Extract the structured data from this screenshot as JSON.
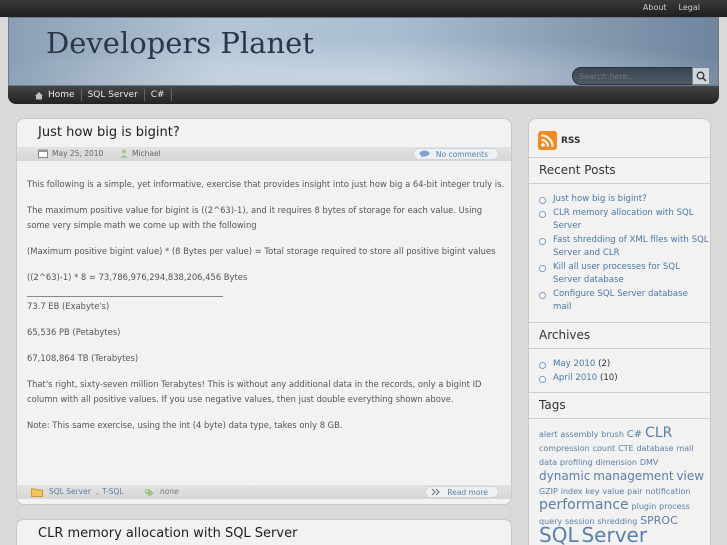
{
  "topbar": {
    "about": "About",
    "legal": "Legal"
  },
  "header": {
    "title": "Developers Planet",
    "search_placeholder": "Search here..."
  },
  "nav": {
    "items": [
      "Home",
      "SQL Server",
      "C#"
    ]
  },
  "post1": {
    "title": "Just how big is bigint?",
    "date": "May 25, 2010",
    "author": "Michael",
    "comments": "No comments",
    "paragraphs": [
      "This following is a simple, yet informative, exercise that provides insight into just how big a 64-bit integer truly is.",
      "The maximum positive value for bigint is ((2^63)-1), and it requires 8 bytes of storage for each value. Using some very simple math we come up with the following",
      "(Maximum positive bigint value) * (8 Bytes per value) = Total storage required to store all positive bigint values",
      "((2^63)-1) * 8 = 73,786,976,294,838,206,456 Bytes"
    ],
    "sizes": [
      "73.7 EB (Exabyte's)",
      "65,536 PB (Petabytes)",
      "67,108,864 TB (Terabytes)"
    ],
    "paragraphs2": [
      "That's right, sixty-seven million Terabytes! This is without any additional data in the records, only a bigint ID column with all positive values. If you use negative values, then just double everything shown above.",
      "Note: This same exercise, using the int (4 byte) data type, takes only 8 GB."
    ],
    "categories": [
      "SQL Server",
      "T-SQL"
    ],
    "category_sep": ",",
    "tags": "none",
    "read_more": "Read more"
  },
  "post2": {
    "title": "CLR memory allocation with SQL Server"
  },
  "sidebar": {
    "rss": "RSS",
    "recent_heading": "Recent Posts",
    "recent": [
      "Just how big is bigint?",
      "CLR memory allocation with SQL Server",
      "Fast shredding of XML files with SQL Server and CLR",
      "Kill all user processes for SQL Server database",
      "Configure SQL Server database mail"
    ],
    "archives_heading": "Archives",
    "archives": [
      {
        "label": "May 2010",
        "count": "(2)"
      },
      {
        "label": "April 2010",
        "count": "(10)"
      }
    ],
    "tags_heading": "Tags",
    "tags": [
      {
        "text": "alert",
        "size": 8
      },
      {
        "text": "assembly",
        "size": 8
      },
      {
        "text": "brush",
        "size": 8
      },
      {
        "text": "C#",
        "size": 10
      },
      {
        "text": "CLR",
        "size": 14
      },
      {
        "text": "compression",
        "size": 8
      },
      {
        "text": "count",
        "size": 8
      },
      {
        "text": "CTE",
        "size": 8
      },
      {
        "text": "database",
        "size": 8
      },
      {
        "text": "mail",
        "size": 8
      },
      {
        "text": "data",
        "size": 8
      },
      {
        "text": "profiling",
        "size": 8
      },
      {
        "text": "dimension",
        "size": 8
      },
      {
        "text": "DMV",
        "size": 8
      },
      {
        "text": "dynamic",
        "size": 12
      },
      {
        "text": "management",
        "size": 12
      },
      {
        "text": "view",
        "size": 12
      },
      {
        "text": "GZIP",
        "size": 8
      },
      {
        "text": "index",
        "size": 8
      },
      {
        "text": "key",
        "size": 8
      },
      {
        "text": "value",
        "size": 8
      },
      {
        "text": "pair",
        "size": 8
      },
      {
        "text": "notification",
        "size": 8
      },
      {
        "text": "performance",
        "size": 14
      },
      {
        "text": "plugin",
        "size": 8
      },
      {
        "text": "process",
        "size": 8
      },
      {
        "text": "query",
        "size": 8
      },
      {
        "text": "session",
        "size": 8
      },
      {
        "text": "shredding",
        "size": 8
      },
      {
        "text": "SPROC",
        "size": 11
      },
      {
        "text": "SQL",
        "size": 20
      },
      {
        "text": "Server",
        "size": 20
      }
    ]
  }
}
